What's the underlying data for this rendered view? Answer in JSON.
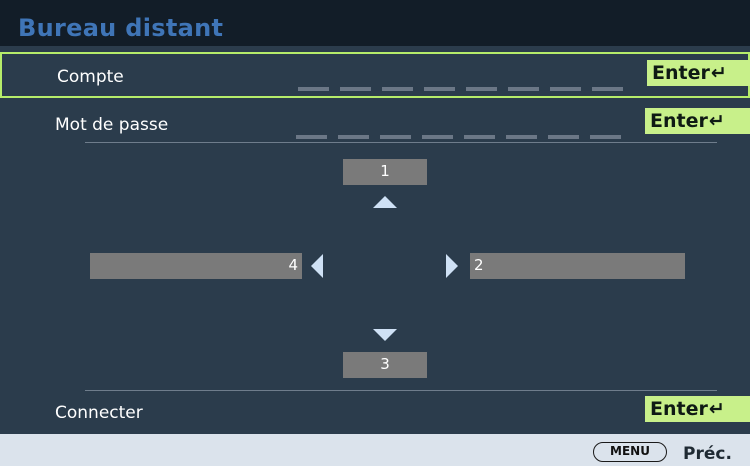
{
  "header": {
    "title": "Bureau distant"
  },
  "rows": {
    "account": {
      "label": "Compte",
      "action": "Enter"
    },
    "password": {
      "label": "Mot de passe",
      "action": "Enter"
    },
    "connect": {
      "label": "Connecter",
      "action": "Enter"
    }
  },
  "slots": {
    "top": "1",
    "right": "2",
    "bottom": "3",
    "left": "4"
  },
  "footer": {
    "menu_key": "MENU",
    "back_label": "Préc."
  },
  "colors": {
    "background": "#2b3c4c",
    "header": "#121d28",
    "title": "#3f75b7",
    "enter_button": "#c8f08a",
    "selection_border": "#b6ec6a",
    "slot": "#7a7a7a",
    "arrow": "#cfe1f5",
    "footer": "#dbe3ec"
  },
  "icons": {
    "enter": "return-arrow-icon",
    "up": "triangle-up-icon",
    "down": "triangle-down-icon",
    "left": "triangle-left-icon",
    "right": "triangle-right-icon"
  }
}
